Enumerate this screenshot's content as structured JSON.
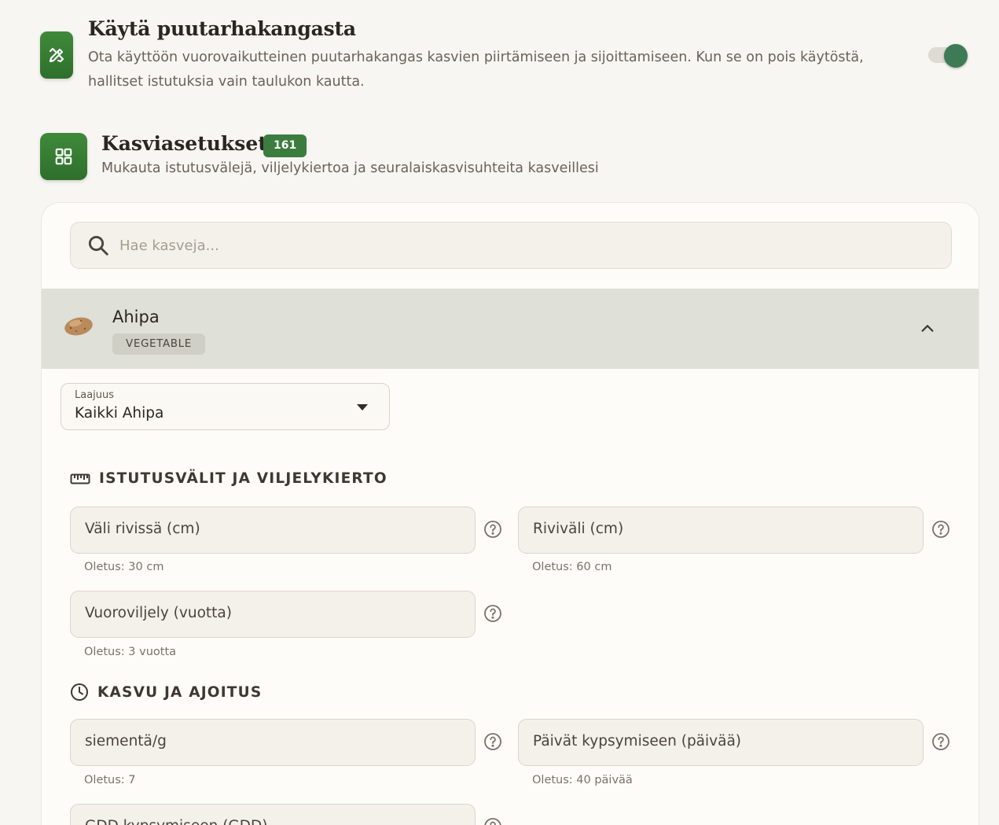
{
  "canvas_setting": {
    "title": "Käytä puutarhakangasta",
    "description": "Ota käyttöön vuorovaikutteinen puutarhakangas kasvien piirtämiseen ja sijoittamiseen. Kun se on pois käytöstä, hallitset istutuksia vain taulukon kautta.",
    "enabled": true
  },
  "plant_settings": {
    "title": "Kasviasetukset",
    "count": "161",
    "description": "Mukauta istutusvälejä, viljelykiertoa ja seuralaiskasvisuhteita kasveillesi"
  },
  "search": {
    "placeholder": "Hae kasveja..."
  },
  "plant": {
    "name": "Ahipa",
    "category": "VEGETABLE"
  },
  "scope": {
    "label": "Laajuus",
    "value": "Kaikki Ahipa"
  },
  "sections": {
    "spacing": {
      "title": "ISTUTUSVÄLIT JA VILJELYKIERTO",
      "fields": [
        {
          "label": "Väli rivissä (cm)",
          "hint": "Oletus: 30 cm"
        },
        {
          "label": "Riviväli (cm)",
          "hint": "Oletus: 60 cm"
        },
        {
          "label": "Vuoroviljely (vuotta)",
          "hint": "Oletus: 3 vuotta"
        }
      ]
    },
    "growth": {
      "title": "KASVU JA AJOITUS",
      "fields": [
        {
          "label": "siementä/g",
          "hint": "Oletus: 7"
        },
        {
          "label": "Päivät kypsymiseen (päivää)",
          "hint": "Oletus: 40 päivää"
        },
        {
          "label": "GDD kypsymiseen (GDD)",
          "hint": ""
        }
      ]
    }
  },
  "icons": {
    "canvas": "pencil-ruler-icon",
    "plants": "grid-icon",
    "search": "search-icon",
    "collapse": "chevron-up-icon",
    "dropdown": "caret-down-icon",
    "spacing": "ruler-icon",
    "growth": "clock-icon",
    "help": "help-circle-icon"
  },
  "colors": {
    "accent": "#3b7d3e",
    "toggle_on": "#3d7a56",
    "selected_row": "#dfe0d8"
  }
}
